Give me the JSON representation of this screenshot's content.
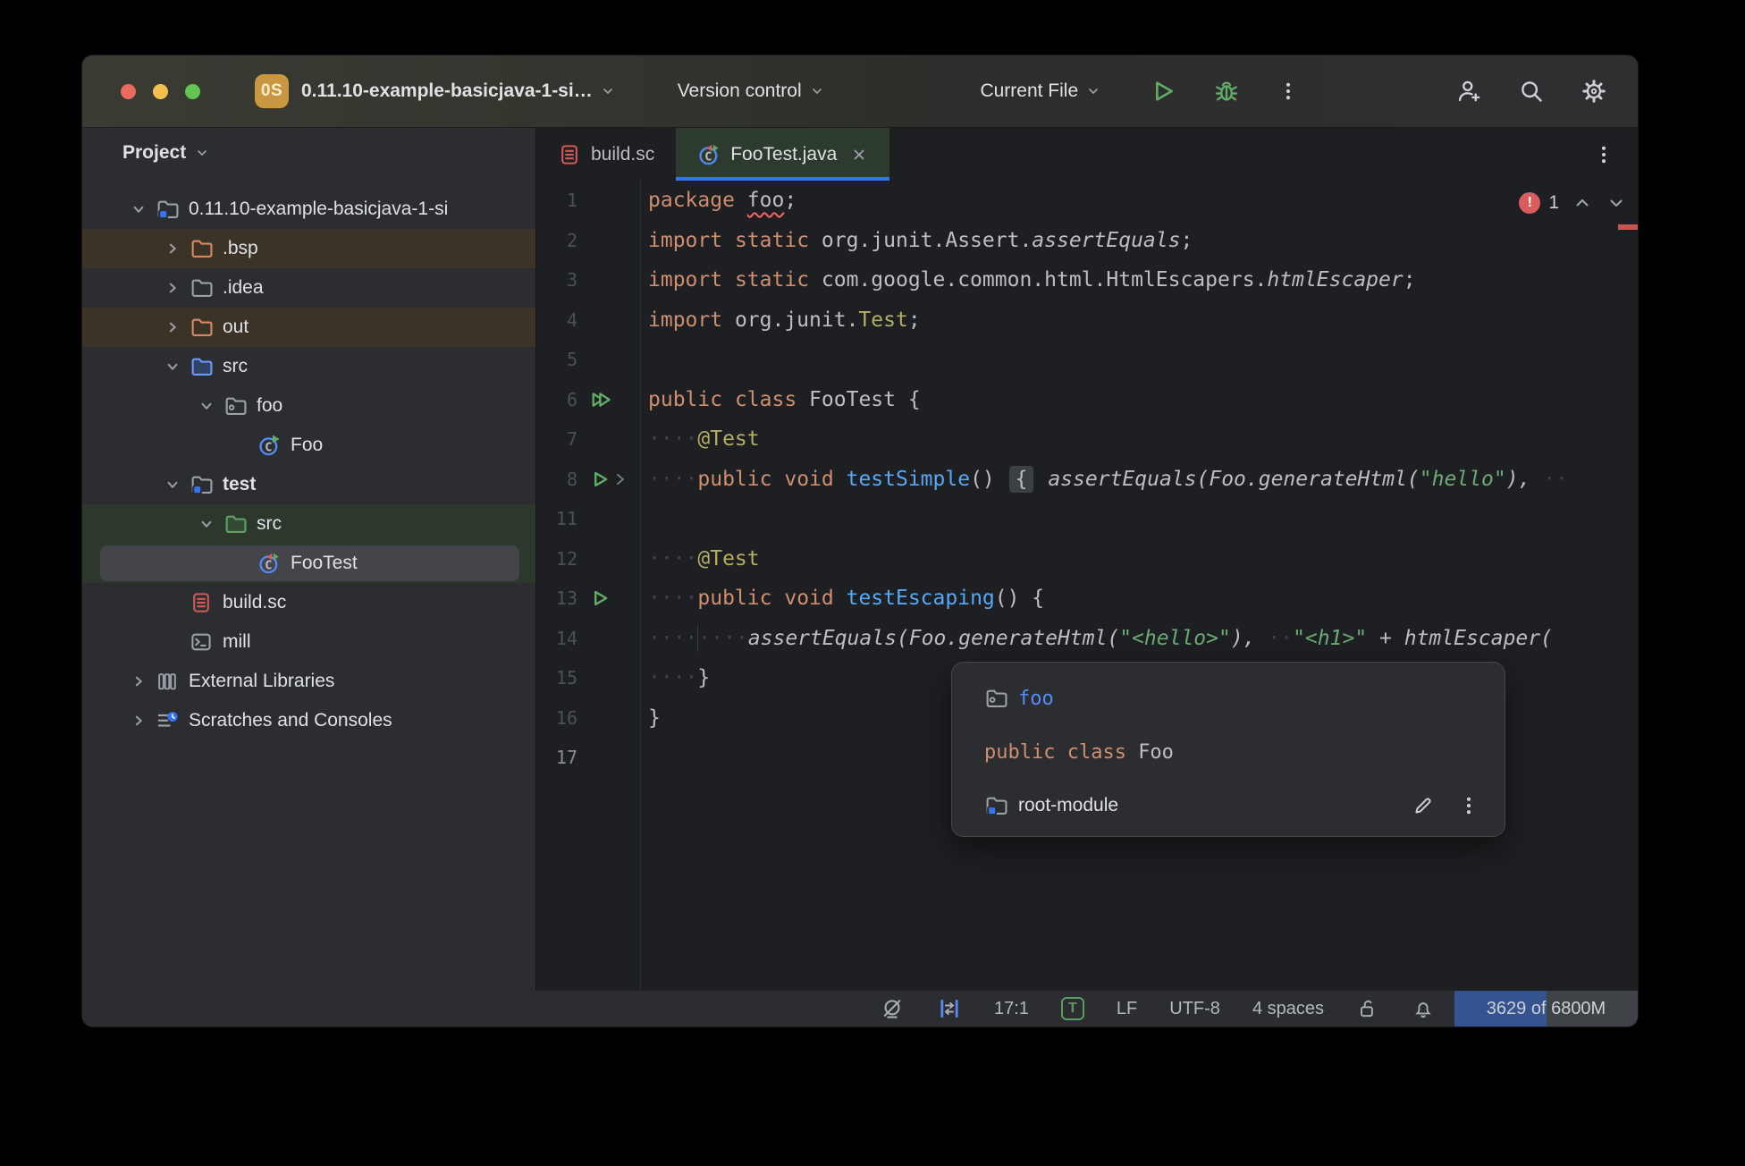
{
  "titlebar": {
    "project_badge": "0S",
    "project_name": "0.11.10-example-basicjava-1-si…",
    "vcs_widget": "Version control",
    "run_widget": "Current File"
  },
  "project_panel": {
    "header": "Project",
    "tree": [
      {
        "label": "0.11.10-example-basicjava-1-si",
        "icon": "module-folder",
        "level": 0,
        "chevron": "open"
      },
      {
        "label": ".bsp",
        "icon": "folder-excluded",
        "level": 1,
        "chevron": "closed",
        "row": "excluded"
      },
      {
        "label": ".idea",
        "icon": "folder",
        "level": 1,
        "chevron": "closed"
      },
      {
        "label": "out",
        "icon": "folder-excluded",
        "level": 1,
        "chevron": "closed",
        "row": "excluded"
      },
      {
        "label": "src",
        "icon": "folder-sources",
        "level": 1,
        "chevron": "open"
      },
      {
        "label": "foo",
        "icon": "package",
        "level": 2,
        "chevron": "open"
      },
      {
        "label": "Foo",
        "icon": "java-class",
        "level": 3,
        "chevron": null
      },
      {
        "label": "test",
        "icon": "module-folder",
        "level": 1,
        "chevron": "open",
        "bold": true
      },
      {
        "label": "src",
        "icon": "folder-test",
        "level": 2,
        "chevron": "open",
        "row": "testsrc"
      },
      {
        "label": "FooTest",
        "icon": "java-test-class",
        "level": 3,
        "chevron": null,
        "row": "testsrc",
        "selected": true
      },
      {
        "label": "build.sc",
        "icon": "scala-file",
        "level": 1,
        "chevron": null
      },
      {
        "label": "mill",
        "icon": "terminal-file",
        "level": 1,
        "chevron": null
      },
      {
        "label": "External Libraries",
        "icon": "libraries",
        "level": 0,
        "chevron": "closed"
      },
      {
        "label": "Scratches and Consoles",
        "icon": "scratches",
        "level": 0,
        "chevron": "closed"
      }
    ]
  },
  "tabs": [
    {
      "label": "build.sc",
      "icon": "scala-file",
      "active": false,
      "closable": false
    },
    {
      "label": "FooTest.java",
      "icon": "java-test-class",
      "active": true,
      "closable": true
    }
  ],
  "editor": {
    "error_count": "1",
    "lines": [
      {
        "num": "1",
        "tokens": [
          [
            "kw",
            "package"
          ],
          [
            "pl",
            " "
          ],
          [
            "err",
            "foo"
          ],
          [
            "pl",
            ";"
          ]
        ]
      },
      {
        "num": "2",
        "tokens": [
          [
            "kw",
            "import"
          ],
          [
            "pl",
            " "
          ],
          [
            "kw",
            "static"
          ],
          [
            "pl",
            " org.junit.Assert."
          ],
          [
            "it",
            "assertEquals"
          ],
          [
            "pl",
            ";"
          ]
        ]
      },
      {
        "num": "3",
        "tokens": [
          [
            "kw",
            "import"
          ],
          [
            "pl",
            " "
          ],
          [
            "kw",
            "static"
          ],
          [
            "pl",
            " com.google.common.html.HtmlEscapers."
          ],
          [
            "it",
            "htmlEscaper"
          ],
          [
            "pl",
            ";"
          ]
        ]
      },
      {
        "num": "4",
        "tokens": [
          [
            "kw",
            "import"
          ],
          [
            "pl",
            " org.junit."
          ],
          [
            "ann",
            "Test"
          ],
          [
            "pl",
            ";"
          ]
        ]
      },
      {
        "num": "5",
        "tokens": []
      },
      {
        "num": "6",
        "gutter": [
          "run-all"
        ],
        "tokens": [
          [
            "kw",
            "public"
          ],
          [
            "pl",
            " "
          ],
          [
            "kw",
            "class"
          ],
          [
            "pl",
            " FooTest {"
          ]
        ]
      },
      {
        "num": "7",
        "tokens": [
          [
            "ws",
            "····"
          ],
          [
            "ann",
            "@Test"
          ]
        ]
      },
      {
        "num": "8",
        "gutter": [
          "run",
          "fold"
        ],
        "tokens": [
          [
            "ws",
            "····"
          ],
          [
            "kw",
            "public"
          ],
          [
            "pl",
            " "
          ],
          [
            "kw",
            "void"
          ],
          [
            "pl",
            " "
          ],
          [
            "mth",
            "testSimple"
          ],
          [
            "pl",
            "() "
          ],
          [
            "fold",
            "{"
          ],
          [
            "it",
            " assertEquals(Foo.generateHtml("
          ],
          [
            "its",
            "\"hello\""
          ],
          [
            "it",
            "), "
          ],
          [
            "ws",
            "··"
          ]
        ]
      },
      {
        "num": "11",
        "tokens": []
      },
      {
        "num": "12",
        "tokens": [
          [
            "ws",
            "····"
          ],
          [
            "ann",
            "@Test"
          ]
        ]
      },
      {
        "num": "13",
        "gutter": [
          "run"
        ],
        "tokens": [
          [
            "ws",
            "····"
          ],
          [
            "kw",
            "public"
          ],
          [
            "pl",
            " "
          ],
          [
            "kw",
            "void"
          ],
          [
            "pl",
            " "
          ],
          [
            "mth",
            "testEscaping"
          ],
          [
            "pl",
            "() {"
          ]
        ]
      },
      {
        "num": "14",
        "tokens": [
          [
            "ws",
            "····"
          ],
          [
            "gd",
            ""
          ],
          [
            "ws",
            "····"
          ],
          [
            "it",
            "assertEquals(Foo.generateHtml("
          ],
          [
            "its",
            "\"<hello>\""
          ],
          [
            "it",
            "), "
          ],
          [
            "ws",
            "··"
          ],
          [
            "its",
            "\"<h1>\""
          ],
          [
            "pl",
            " + "
          ],
          [
            "it",
            "htmlEscaper("
          ]
        ]
      },
      {
        "num": "15",
        "tokens": [
          [
            "ws",
            "····"
          ],
          [
            "pl",
            "}"
          ]
        ]
      },
      {
        "num": "16",
        "tokens": [
          [
            "pl",
            "}"
          ]
        ]
      },
      {
        "num": "17",
        "tokens": [],
        "current": true
      }
    ]
  },
  "popup": {
    "rows": [
      {
        "kind": "link",
        "icon": "package",
        "label": "foo"
      },
      {
        "kind": "code",
        "tokens": [
          [
            "kw",
            "public class "
          ],
          [
            "pl",
            "Foo"
          ]
        ]
      },
      {
        "kind": "plain",
        "icon": "module-folder",
        "label": "root-module",
        "actions": [
          {
            "icon": "pencil",
            "name": "rename-action"
          },
          {
            "icon": "kebab",
            "name": "more-actions"
          }
        ]
      }
    ]
  },
  "statusbar": {
    "items": [
      {
        "type": "icon",
        "icon": "highlighting-off",
        "name": "highlighting-status"
      },
      {
        "type": "icon",
        "icon": "column-mode",
        "name": "column-mode-indicator"
      },
      {
        "type": "text",
        "text": "17:1",
        "name": "caret-position"
      },
      {
        "type": "badge",
        "text": "T",
        "name": "textmate-badge"
      },
      {
        "type": "text",
        "text": "LF",
        "name": "line-separator"
      },
      {
        "type": "text",
        "text": "UTF-8",
        "name": "file-encoding"
      },
      {
        "type": "text",
        "text": "4 spaces",
        "name": "indent-style"
      },
      {
        "type": "icon",
        "icon": "lock-open",
        "name": "readonly-status"
      },
      {
        "type": "icon",
        "icon": "bell",
        "name": "notifications"
      }
    ],
    "memory": {
      "text": "3629 of 6800M",
      "fill_percent": 50
    }
  },
  "colors": {
    "accent": "#3574f0",
    "run_green": "#5fad65",
    "error_red": "#db5c5c",
    "excluded_row": "#3c3328",
    "test_row": "#2d382d"
  }
}
